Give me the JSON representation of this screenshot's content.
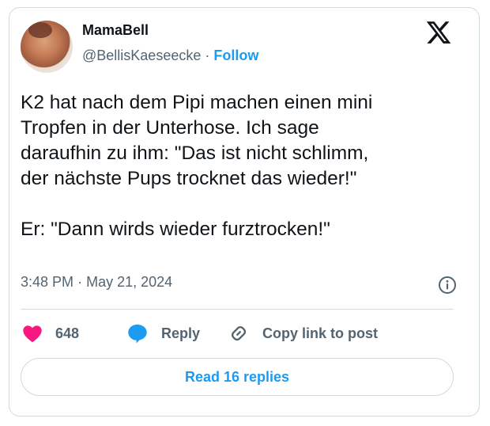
{
  "author": {
    "name": "MamaBell",
    "handle": "@BellisKaeseecke",
    "separator": "·",
    "follow_label": "Follow"
  },
  "tweet": {
    "text": "K2 hat nach dem Pipi machen einen mini\nTropfen in der Unterhose. Ich sage\ndaraufhin zu ihm: \"Das ist nicht schlimm,\nder nächste Pups trocknet das wieder!\"\n\nEr: \"Dann wirds wieder furztrocken!\"",
    "time": "3:48 PM",
    "time_separator": "·",
    "date": "May 21, 2024"
  },
  "actions": {
    "likes": "648",
    "reply_label": "Reply",
    "copy_label": "Copy link to post"
  },
  "read_replies_label": "Read 16 replies",
  "icons": {
    "brand": "x-logo-icon",
    "info": "info-icon",
    "like": "heart-icon",
    "reply": "speech-bubble-icon",
    "copy": "link-icon"
  },
  "colors": {
    "accent": "#1d9bf0",
    "heart": "#f91880",
    "text": "#0f1419",
    "muted": "#536471",
    "border": "#cfd9de"
  }
}
